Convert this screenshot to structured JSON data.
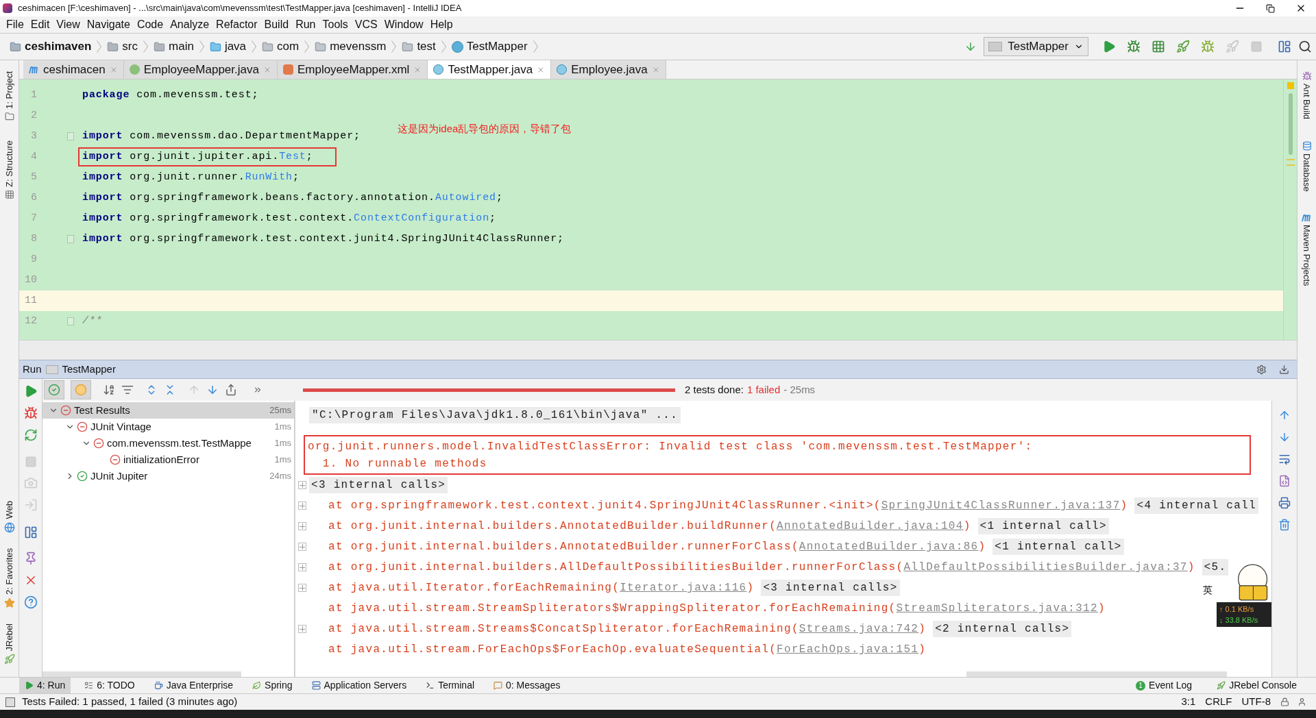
{
  "window": {
    "title": "ceshimacen [F:\\ceshimaven] - ...\\src\\main\\java\\com\\mevenssm\\test\\TestMapper.java [ceshimaven] - IntelliJ IDEA"
  },
  "menu": [
    "File",
    "Edit",
    "View",
    "Navigate",
    "Code",
    "Analyze",
    "Refactor",
    "Build",
    "Run",
    "Tools",
    "VCS",
    "Window",
    "Help"
  ],
  "breadcrumbs": [
    {
      "label": "ceshimaven",
      "kind": "module"
    },
    {
      "label": "src",
      "kind": "folder"
    },
    {
      "label": "main",
      "kind": "folder"
    },
    {
      "label": "java",
      "kind": "source"
    },
    {
      "label": "com",
      "kind": "package"
    },
    {
      "label": "mevenssm",
      "kind": "package"
    },
    {
      "label": "test",
      "kind": "package"
    },
    {
      "label": "TestMapper",
      "kind": "class"
    }
  ],
  "run_config": "TestMapper",
  "left_tool_windows": {
    "top": [
      {
        "label": "1: Project",
        "kind": "project"
      },
      {
        "label": "Z: Structure",
        "kind": "structure"
      }
    ],
    "bottom": [
      {
        "label": "Web",
        "kind": "web"
      },
      {
        "label": "2: Favorites",
        "kind": "favorites"
      },
      {
        "label": "JRebel",
        "kind": "jrebel"
      }
    ]
  },
  "right_tool_windows": [
    {
      "label": "Ant Build",
      "kind": "ant"
    },
    {
      "label": "Database",
      "kind": "database"
    },
    {
      "label": "Maven Projects",
      "kind": "maven"
    }
  ],
  "editor_tabs": [
    {
      "label": "ceshimacen",
      "kind": "maven",
      "selected": false
    },
    {
      "label": "EmployeeMapper.java",
      "kind": "interface",
      "selected": false
    },
    {
      "label": "EmployeeMapper.xml",
      "kind": "xml",
      "selected": false
    },
    {
      "label": "TestMapper.java",
      "kind": "test",
      "selected": true
    },
    {
      "label": "Employee.java",
      "kind": "class",
      "selected": false
    }
  ],
  "editor": {
    "lines": [
      {
        "number": "1",
        "tokens": [
          {
            "text": "package",
            "kind": "keyword"
          },
          {
            "text": " com.mevenssm.test;",
            "kind": "plain"
          }
        ]
      },
      {
        "number": "2"
      },
      {
        "number": "3",
        "fold": true,
        "tokens": [
          {
            "text": "import",
            "kind": "keyword"
          },
          {
            "text": " com.mevenssm.dao.DepartmentMapper;",
            "kind": "plain"
          }
        ],
        "note": "这是因为idea乱导包的原因，导错了包"
      },
      {
        "number": "4",
        "boxed": true,
        "tokens": [
          {
            "text": "import",
            "kind": "keyword"
          },
          {
            "text": " org.junit.jupiter.api.",
            "kind": "plain"
          },
          {
            "text": "Test",
            "kind": "class"
          },
          {
            "text": ";",
            "kind": "plain"
          }
        ]
      },
      {
        "number": "5",
        "tokens": [
          {
            "text": "import",
            "kind": "keyword"
          },
          {
            "text": " org.junit.runner.",
            "kind": "plain"
          },
          {
            "text": "RunWith",
            "kind": "class"
          },
          {
            "text": ";",
            "kind": "plain"
          }
        ]
      },
      {
        "number": "6",
        "tokens": [
          {
            "text": "import",
            "kind": "keyword"
          },
          {
            "text": " org.springframework.beans.factory.annotation.",
            "kind": "plain"
          },
          {
            "text": "Autowired",
            "kind": "class"
          },
          {
            "text": ";",
            "kind": "plain"
          }
        ]
      },
      {
        "number": "7",
        "tokens": [
          {
            "text": "import",
            "kind": "keyword"
          },
          {
            "text": " org.springframework.test.context.",
            "kind": "plain"
          },
          {
            "text": "ContextConfiguration",
            "kind": "class"
          },
          {
            "text": ";",
            "kind": "plain"
          }
        ]
      },
      {
        "number": "8",
        "fold": true,
        "tokens": [
          {
            "text": "import",
            "kind": "keyword"
          },
          {
            "text": " org.springframework.test.context.junit4.SpringJUnit4ClassRunner;",
            "kind": "plain"
          }
        ]
      },
      {
        "number": "9"
      },
      {
        "number": "10"
      },
      {
        "number": "11",
        "current": true
      },
      {
        "number": "12",
        "fold": true,
        "tokens": [
          {
            "text": "/**",
            "kind": "comment"
          }
        ]
      }
    ]
  },
  "run": {
    "label": "Run",
    "config": "TestMapper",
    "toolbar": [
      {
        "kind": "passed",
        "selected": true
      },
      {
        "kind": "ignored",
        "selected": true
      }
    ],
    "progress": {
      "level": 1,
      "failed": true
    },
    "summary": "2 tests done:",
    "failed_count": "1 failed",
    "duration": "- 25ms",
    "tree": [
      {
        "label": "Test Results",
        "failed": true,
        "time": "25ms",
        "selected": true,
        "expanded": true,
        "children": [
          {
            "label": "JUnit Vintage",
            "failed": true,
            "time": "1ms",
            "selected": false,
            "expanded": true,
            "children": [
              {
                "label": "com.mevenssm.test.TestMappe",
                "failed": true,
                "time": "1ms",
                "selected": false,
                "expanded": true,
                "children": [
                  {
                    "label": "initializationError",
                    "failed": true,
                    "time": "1ms",
                    "selected": false
                  }
                ]
              }
            ]
          },
          {
            "label": "JUnit Jupiter",
            "failed": false,
            "time": "24ms",
            "selected": false,
            "expanded": false
          }
        ]
      }
    ],
    "console": {
      "command": "\"C:\\Program Files\\Java\\jdk1.8.0_161\\bin\\java\" ...",
      "error_lines": [
        "org.junit.runners.model.InvalidTestClassError: Invalid test class 'com.mevenssm.test.TestMapper':",
        "  1. No runnable methods"
      ],
      "lines": [
        {
          "kind": "fold",
          "fold": "<3 internal calls>",
          "expandable": true
        },
        {
          "kind": "frame",
          "text": "at org.springframework.test.context.junit4.SpringJUnit4ClassRunner.<init>(",
          "link": "SpringJUnit4ClassRunner.java:137",
          "after": ")",
          "fold": "<4 internal call",
          "expandable": true
        },
        {
          "kind": "frame",
          "text": "at org.junit.internal.builders.AnnotatedBuilder.buildRunner(",
          "link": "AnnotatedBuilder.java:104",
          "after": ")",
          "fold": "<1 internal call>",
          "expandable": true
        },
        {
          "kind": "frame",
          "text": "at org.junit.internal.builders.AnnotatedBuilder.runnerForClass(",
          "link": "AnnotatedBuilder.java:86",
          "after": ")",
          "fold": "<1 internal call>",
          "expandable": true
        },
        {
          "kind": "frame",
          "text": "at org.junit.internal.builders.AllDefaultPossibilitiesBuilder.runnerForClass(",
          "link": "AllDefaultPossibilitiesBuilder.java:37",
          "after": ")",
          "fold": "<5.",
          "expandable": true
        },
        {
          "kind": "frame",
          "text": "at java.util.Iterator.forEachRemaining(",
          "link": "Iterator.java:116",
          "after": ")",
          "fold": "<3 internal calls>",
          "expandable": true
        },
        {
          "kind": "frame",
          "text": "at java.util.stream.StreamSpliterators$WrappingSpliterator.forEachRemaining(",
          "link": "StreamSpliterators.java:312",
          "after": ")"
        },
        {
          "kind": "frame",
          "text": "at java.util.stream.Streams$ConcatSpliterator.forEachRemaining(",
          "link": "Streams.java:742",
          "after": ")",
          "fold": "<2 internal calls>",
          "expandable": true
        },
        {
          "kind": "frame",
          "text": "at java.util.stream.ForEachOps$ForEachOp.evaluateSequential(",
          "link": "ForEachOps.java:151",
          "after": ")"
        }
      ]
    }
  },
  "widget": {
    "ime": "英",
    "upload": "↑ 0.1 KB/s",
    "download": "↓ 33.8 KB/s"
  },
  "bottom_tabs": [
    {
      "label": "4: Run",
      "kind": "run",
      "selected": true
    },
    {
      "label": "6: TODO",
      "kind": "todo",
      "selected": false
    },
    {
      "label": "Java Enterprise",
      "kind": "javaee",
      "selected": false
    },
    {
      "label": "Spring",
      "kind": "spring",
      "selected": false
    },
    {
      "label": "Application Servers",
      "kind": "servers",
      "selected": false
    },
    {
      "label": "Terminal",
      "kind": "terminal",
      "selected": false
    },
    {
      "label": "0: Messages",
      "kind": "messages",
      "selected": false
    }
  ],
  "bottom_right_tabs": [
    {
      "label": "Event Log",
      "badge": "1"
    },
    {
      "label": "JRebel Console"
    }
  ],
  "status_bar": {
    "message": "Tests Failed: 1 passed, 1 failed (3 minutes ago)",
    "position": "3:1",
    "line_separator": "CRLF",
    "encoding": "UTF-8"
  }
}
